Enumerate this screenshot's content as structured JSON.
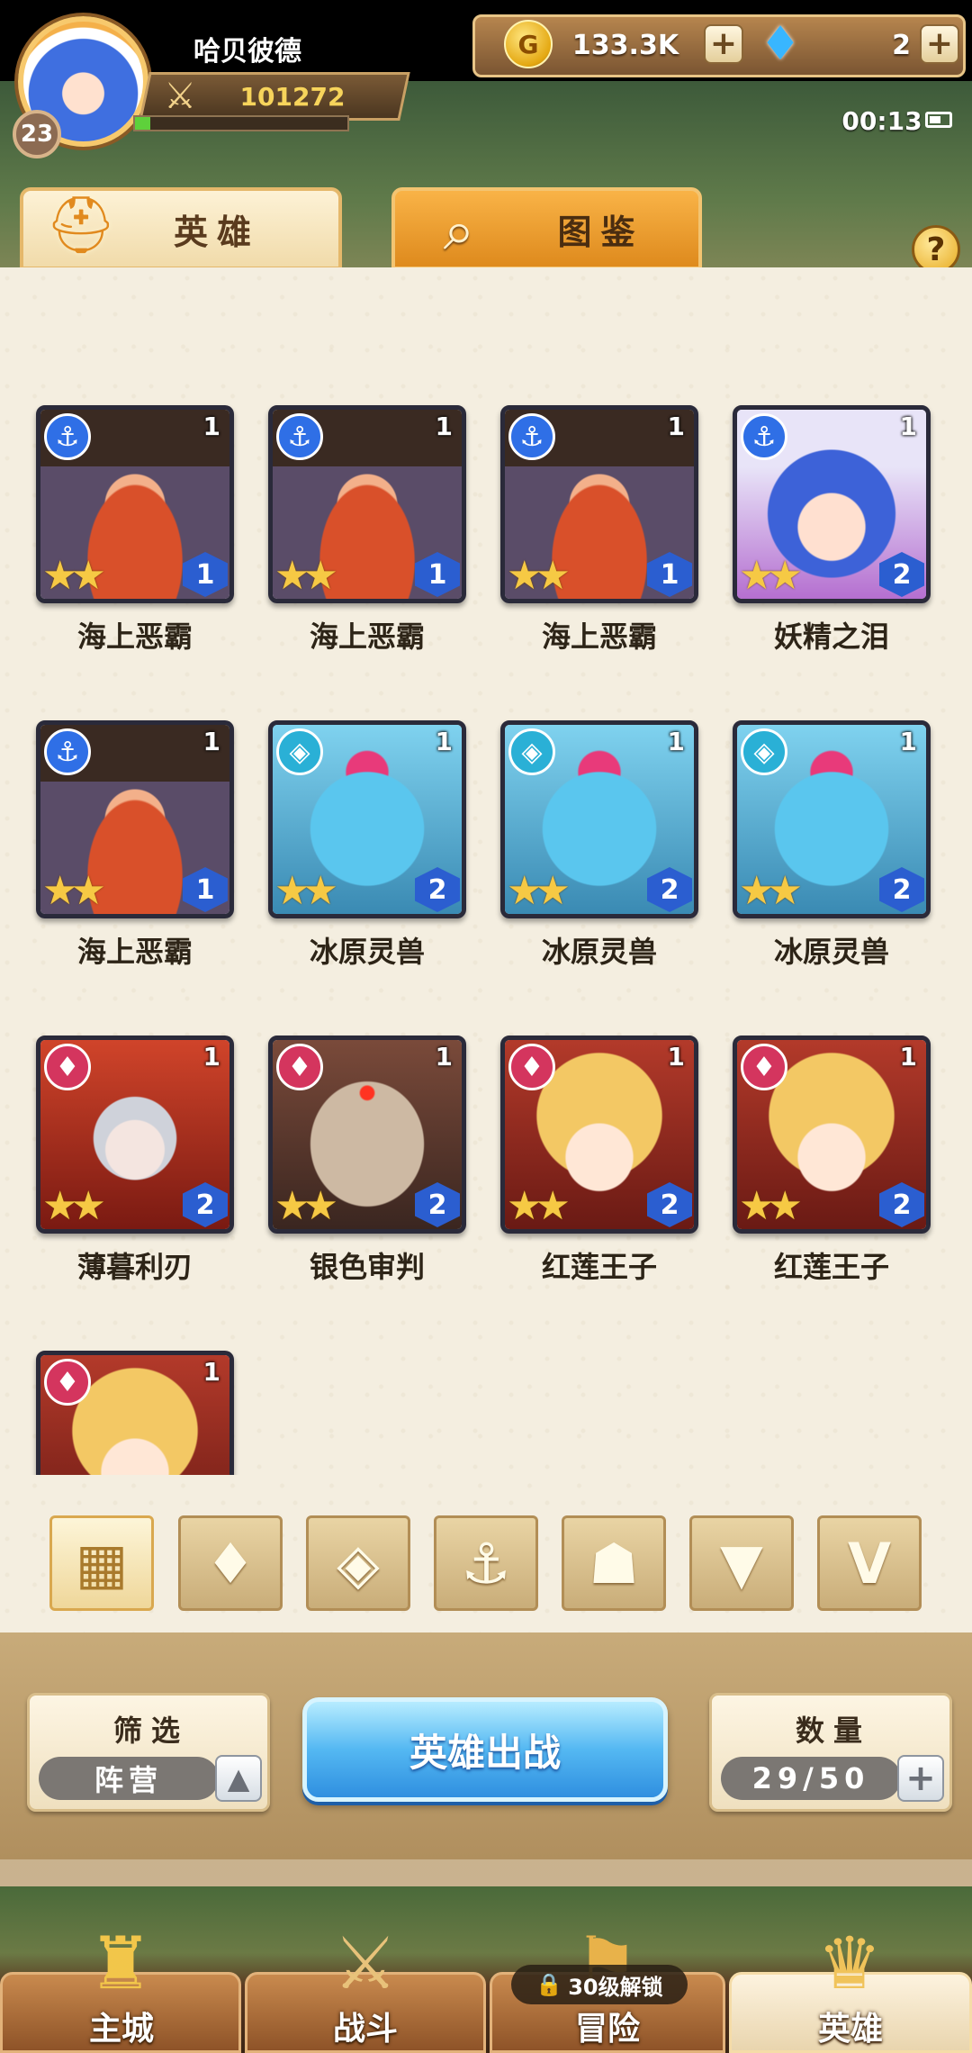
{
  "player": {
    "name": "哈贝彼德",
    "level": "23",
    "power": "101272",
    "exp_fraction": 0.07
  },
  "resources": {
    "gold": "133.3K",
    "gems": "2",
    "plus": "+"
  },
  "clock": "00:13",
  "tabs": {
    "heroes": "英雄",
    "codex": "图鉴"
  },
  "help": "?",
  "heroes": [
    {
      "name": "海上恶霸",
      "faction": "anchor",
      "faction_icon": "⚓",
      "count": "1",
      "tier": "1",
      "stars": "★★"
    },
    {
      "name": "海上恶霸",
      "faction": "anchor",
      "faction_icon": "⚓",
      "count": "1",
      "tier": "1",
      "stars": "★★"
    },
    {
      "name": "海上恶霸",
      "faction": "anchor",
      "faction_icon": "⚓",
      "count": "1",
      "tier": "1",
      "stars": "★★"
    },
    {
      "name": "妖精之泪",
      "faction": "anchor",
      "faction_icon": "⚓",
      "count": "1",
      "tier": "2",
      "stars": "★★"
    },
    {
      "name": "海上恶霸",
      "faction": "anchor",
      "faction_icon": "⚓",
      "count": "1",
      "tier": "1",
      "stars": "★★"
    },
    {
      "name": "冰原灵兽",
      "faction": "ice",
      "faction_icon": "◈",
      "count": "1",
      "tier": "2",
      "stars": "★★"
    },
    {
      "name": "冰原灵兽",
      "faction": "ice",
      "faction_icon": "◈",
      "count": "1",
      "tier": "2",
      "stars": "★★"
    },
    {
      "name": "冰原灵兽",
      "faction": "ice",
      "faction_icon": "◈",
      "count": "1",
      "tier": "2",
      "stars": "★★"
    },
    {
      "name": "薄暮利刃",
      "faction": "fire",
      "faction_icon": "♦",
      "count": "1",
      "tier": "2",
      "stars": "★★"
    },
    {
      "name": "银色审判",
      "faction": "fire",
      "faction_icon": "♦",
      "count": "1",
      "tier": "2",
      "stars": "★★"
    },
    {
      "name": "红莲王子",
      "faction": "fire",
      "faction_icon": "♦",
      "count": "1",
      "tier": "2",
      "stars": "★★"
    },
    {
      "name": "红莲王子",
      "faction": "fire",
      "faction_icon": "♦",
      "count": "1",
      "tier": "2",
      "stars": "★★"
    },
    {
      "name": "",
      "faction": "fire",
      "faction_icon": "♦",
      "count": "1",
      "tier": "",
      "stars": ""
    }
  ],
  "filters": [
    {
      "icon": "▦",
      "name": "filter-all",
      "active": true
    },
    {
      "icon": "♦",
      "name": "filter-flame",
      "active": false
    },
    {
      "icon": "◈",
      "name": "filter-ice",
      "active": false
    },
    {
      "icon": "⚓",
      "name": "filter-anchor",
      "active": false
    },
    {
      "icon": "☗",
      "name": "filter-wolf",
      "active": false
    },
    {
      "icon": "▼",
      "name": "filter-demon",
      "active": false
    },
    {
      "icon": "V",
      "name": "filter-horns",
      "active": false
    }
  ],
  "sort": {
    "title": "筛选",
    "value": "阵营",
    "toggle_icon": "▲"
  },
  "deploy_label": "英雄出战",
  "capacity": {
    "title": "数量",
    "value": "29/50",
    "plus": "+"
  },
  "nav": [
    {
      "label": "主城",
      "icon": "♜",
      "active": false
    },
    {
      "label": "战斗",
      "icon": "⚔",
      "active": false
    },
    {
      "label": "冒险",
      "icon": "⚑",
      "active": false,
      "lock_text": "30级解锁",
      "lock_icon": "🔒"
    },
    {
      "label": "英雄",
      "icon": "♛",
      "active": true
    }
  ]
}
